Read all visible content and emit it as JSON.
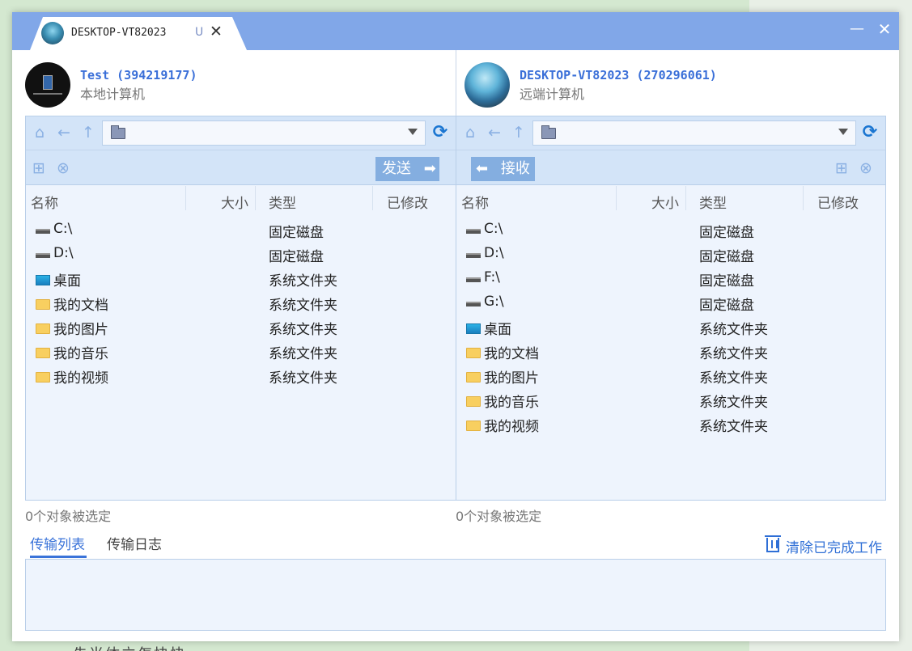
{
  "tab": {
    "title": "DESKTOP-VT82023",
    "indicator": "U"
  },
  "local": {
    "name": "Test (394219177)",
    "subtitle": "本地计算机",
    "action_label": "发送",
    "columns": [
      "名称",
      "大小",
      "类型",
      "已修改"
    ],
    "rows": [
      {
        "name": "C:\\",
        "type": "固定磁盘",
        "icon": "drive-icon"
      },
      {
        "name": "D:\\",
        "type": "固定磁盘",
        "icon": "drive-icon"
      },
      {
        "name": "桌面",
        "type": "系统文件夹",
        "icon": "desktop-icon"
      },
      {
        "name": "我的文档",
        "type": "系统文件夹",
        "icon": "folder-icon"
      },
      {
        "name": "我的图片",
        "type": "系统文件夹",
        "icon": "folder-icon"
      },
      {
        "name": "我的音乐",
        "type": "系统文件夹",
        "icon": "folder-icon"
      },
      {
        "name": "我的视频",
        "type": "系统文件夹",
        "icon": "folder-icon"
      }
    ],
    "status": "0个对象被选定"
  },
  "remote": {
    "name": "DESKTOP-VT82023 (270296061)",
    "subtitle": "远端计算机",
    "action_label": "接收",
    "columns": [
      "名称",
      "大小",
      "类型",
      "已修改"
    ],
    "rows": [
      {
        "name": "C:\\",
        "type": "固定磁盘",
        "icon": "drive-icon"
      },
      {
        "name": "D:\\",
        "type": "固定磁盘",
        "icon": "drive-icon"
      },
      {
        "name": "F:\\",
        "type": "固定磁盘",
        "icon": "drive-icon"
      },
      {
        "name": "G:\\",
        "type": "固定磁盘",
        "icon": "drive-icon"
      },
      {
        "name": "桌面",
        "type": "系统文件夹",
        "icon": "desktop-icon"
      },
      {
        "name": "我的文档",
        "type": "系统文件夹",
        "icon": "folder-icon"
      },
      {
        "name": "我的图片",
        "type": "系统文件夹",
        "icon": "folder-icon"
      },
      {
        "name": "我的音乐",
        "type": "系统文件夹",
        "icon": "folder-icon"
      },
      {
        "name": "我的视频",
        "type": "系统文件夹",
        "icon": "folder-icon"
      }
    ],
    "status": "0个对象被选定"
  },
  "bottom": {
    "tabs": [
      "传输列表",
      "传输日志"
    ],
    "clear_label": "清除已完成工作"
  },
  "background_text": "先当体立怎快快",
  "colors": {
    "accent": "#3a73d9",
    "titlebar": "#81a7e8",
    "panel": "#eef4fd",
    "toolbar": "#d3e4f8"
  }
}
